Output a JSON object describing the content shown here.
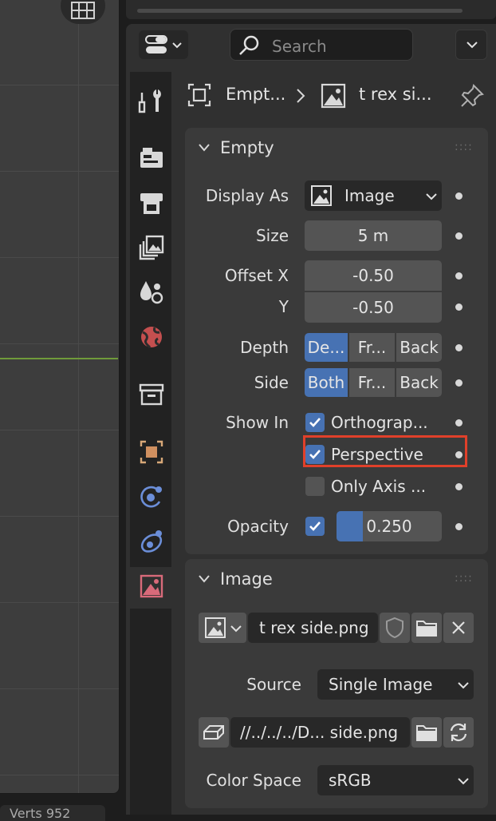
{
  "viewport": {
    "status_text": "Verts 952"
  },
  "header": {
    "search_placeholder": "Search"
  },
  "breadcrumb": {
    "object": "Empt...",
    "data": "t rex si..."
  },
  "empty_panel": {
    "title": "Empty",
    "display_as": {
      "label": "Display As",
      "value": "Image"
    },
    "size": {
      "label": "Size",
      "value": "5 m"
    },
    "offset_x": {
      "label": "Offset X",
      "value": "-0.50"
    },
    "offset_y": {
      "label": "Y",
      "value": "-0.50"
    },
    "depth": {
      "label": "Depth",
      "options": [
        "De...",
        "Fr...",
        "Back"
      ],
      "selected": "De..."
    },
    "side": {
      "label": "Side",
      "options": [
        "Both",
        "Fr...",
        "Back"
      ],
      "selected": "Both"
    },
    "show_in": {
      "label": "Show In",
      "orthographic": {
        "label": "Orthograp...",
        "checked": true
      },
      "perspective": {
        "label": "Perspective",
        "checked": true
      },
      "only_axis": {
        "label": "Only Axis ...",
        "checked": false
      }
    },
    "opacity": {
      "label": "Opacity",
      "enabled": true,
      "value": "0.250",
      "fraction": 0.25
    }
  },
  "image_panel": {
    "title": "Image",
    "image_name": "t rex side.png",
    "source": {
      "label": "Source",
      "value": "Single Image"
    },
    "filepath": "//../../../D... side.png",
    "color_space": {
      "label": "Color Space",
      "value": "sRGB"
    }
  },
  "colors": {
    "accent": "#4772b3",
    "highlight_box": "#e0402a",
    "viewport_axis": "#6f9a3a"
  },
  "icons": [
    "grid-icon",
    "editor-type-icon",
    "search-icon",
    "chevron-down-icon",
    "tool-icon",
    "render-icon",
    "output-icon",
    "view-layer-icon",
    "scene-icon",
    "world-icon",
    "collection-icon",
    "object-icon",
    "physics-icon",
    "constraints-icon",
    "object-data-image-icon",
    "pin-icon",
    "shield-icon",
    "folder-icon",
    "close-icon",
    "reload-icon"
  ]
}
